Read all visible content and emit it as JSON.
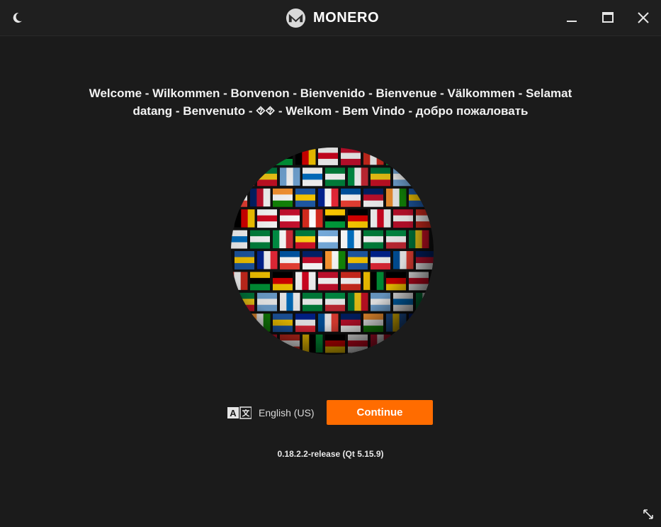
{
  "titlebar": {
    "app_name": "MONERO",
    "theme_icon": "moon-icon",
    "logo_icon": "monero-logo-icon",
    "minimize_icon": "minimize-icon",
    "maximize_icon": "maximize-icon",
    "close_icon": "close-icon"
  },
  "welcome": {
    "line1": "Welcome - Wilkommen - Bonvenon - Bienvenido - Bienvenue - Välkommen - Selamat",
    "line2": "datang - Benvenuto - ⯑⯑ - Welkom - Bem Vindo - добро пожаловать"
  },
  "globe": {
    "icon": "flags-globe-image"
  },
  "language": {
    "icon": "translate-icon",
    "selected": "English (US)"
  },
  "continue_label": "Continue",
  "version": "0.18.2.2-release (Qt 5.15.9)",
  "resize_icon": "resize-diagonal-icon",
  "colors": {
    "accent": "#ff6c00",
    "background": "#1b1b1b",
    "titlebar": "#1f1f1f"
  }
}
